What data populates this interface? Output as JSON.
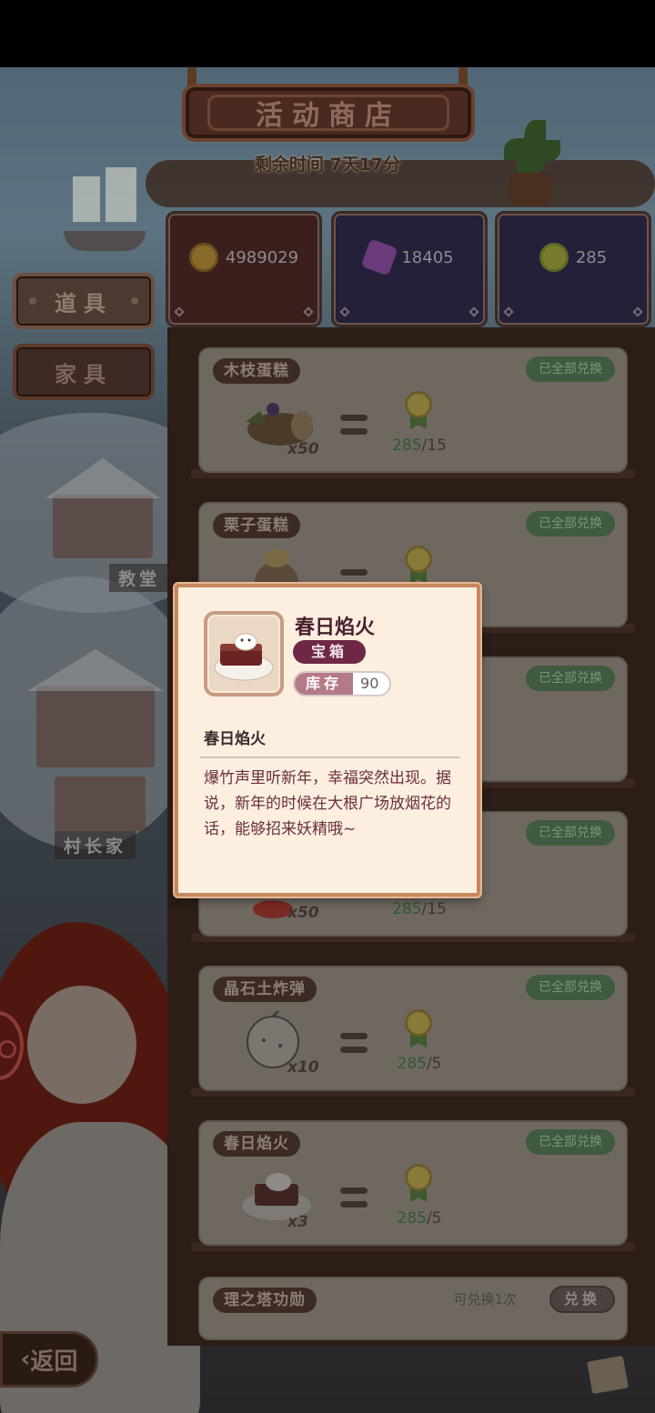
{
  "shop": {
    "title": "活动商店",
    "timer": "剩余时间 7天17分"
  },
  "currencies": [
    {
      "icon": "gold-coin-icon",
      "value": "4989029",
      "color": "#8a6a2a"
    },
    {
      "icon": "purple-crystal-icon",
      "value": "18405",
      "color": "#7a4a8a"
    },
    {
      "icon": "star-medal-icon",
      "value": "285",
      "color": "#6a7a2a"
    }
  ],
  "tabs": {
    "props": "道具",
    "furniture": "家具"
  },
  "map_labels": {
    "church": "教堂",
    "chief": "村长家"
  },
  "items": [
    {
      "name": "木枝蛋糕",
      "status": "已全部兑换",
      "qty": "x50",
      "owned": "285",
      "cost": "/15"
    },
    {
      "name": "栗子蛋糕",
      "status": "已全部兑换",
      "qty": "",
      "owned": "",
      "cost": ""
    },
    {
      "name": "",
      "status": "已全部兑换",
      "qty": "",
      "owned": "",
      "cost": ""
    },
    {
      "name": "",
      "status": "已全部兑换",
      "qty": "x50",
      "owned": "285",
      "cost": "/15"
    },
    {
      "name": "晶石土炸弹",
      "status": "已全部兑换",
      "qty": "x10",
      "owned": "285",
      "cost": "/5"
    },
    {
      "name": "春日焰火",
      "status": "已全部兑换",
      "qty": "x3",
      "owned": "285",
      "cost": "/5"
    }
  ],
  "last_item": {
    "name": "理之塔功勋",
    "note": "可兑换1次",
    "button": "兑换"
  },
  "popup": {
    "title": "春日焰火",
    "type": "宝箱",
    "stock_label": "库存",
    "stock_value": "90",
    "subtitle": "春日焰火",
    "description": "爆竹声里听新年，幸福突然出现。据说，新年的时候在大根广场放烟花的话，能够招来妖精哦~"
  },
  "back_button": "返回"
}
